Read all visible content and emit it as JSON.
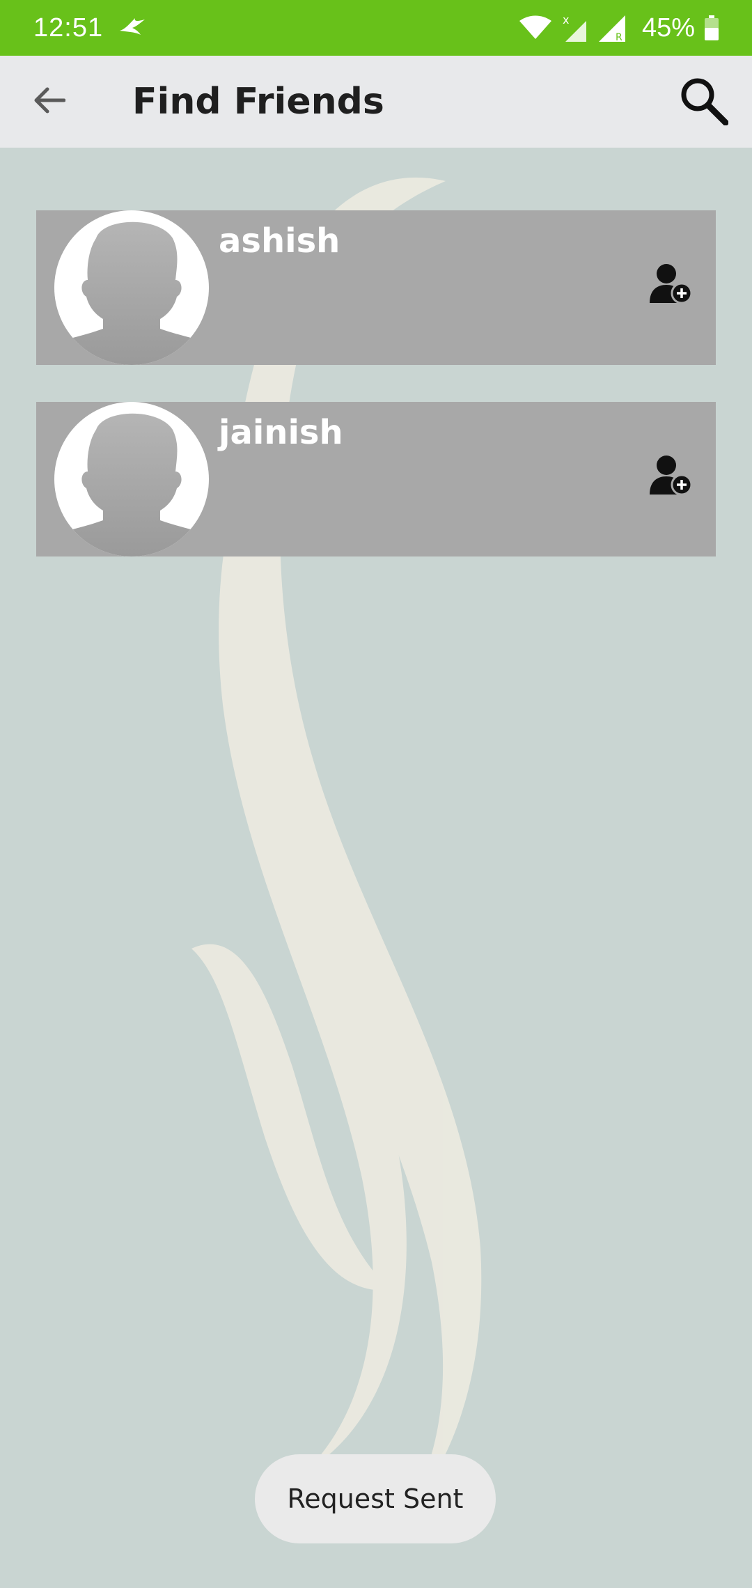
{
  "status_bar": {
    "time": "12:51",
    "battery": "45%",
    "icons": [
      "messenger-bird-icon",
      "wifi-icon",
      "signal-x-icon",
      "signal-roaming-icon",
      "battery-icon"
    ],
    "color": "#68c11a"
  },
  "app_bar": {
    "title": "Find Friends",
    "back_icon": "arrow-back-icon",
    "search_icon": "search-icon"
  },
  "friends": [
    {
      "name": "ashish",
      "action_icon": "add-friend-icon"
    },
    {
      "name": "jainish",
      "action_icon": "add-friend-icon"
    }
  ],
  "toast": {
    "text": "Request Sent"
  },
  "colors": {
    "background": "#c9d5d2",
    "card": "#a8a8a8",
    "app_bar": "#e8e9eb"
  }
}
